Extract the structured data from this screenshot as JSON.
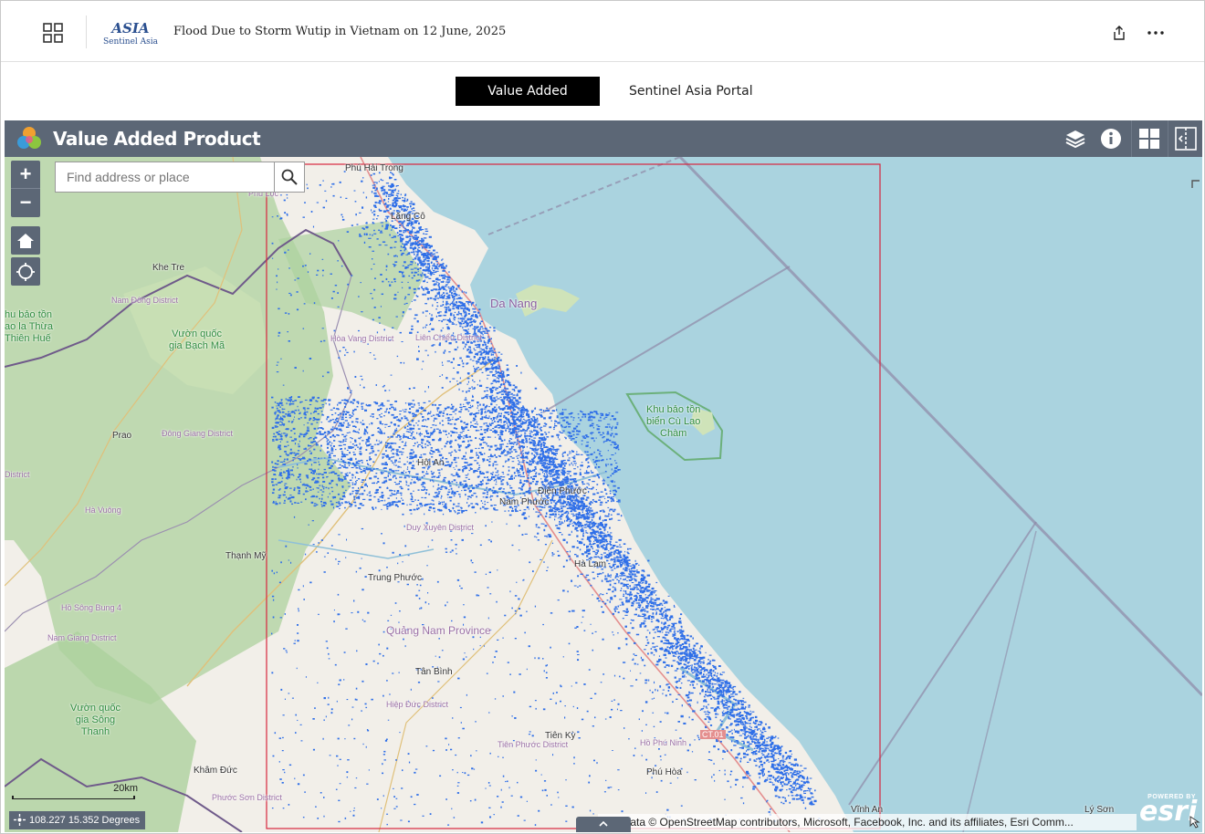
{
  "header": {
    "title": "Flood Due to Storm Wutip in Vietnam on 12 June, 2025",
    "logo_mark": "ASIA",
    "logo_text": "Sentinel Asia",
    "icons": {
      "launcher": "app-launcher-icon",
      "share": "share-icon",
      "more": "more-icon"
    }
  },
  "nav": {
    "tabs": [
      {
        "label": "Value Added Product",
        "active": true
      },
      {
        "label": "Sentinel Asia Portal",
        "active": false
      }
    ]
  },
  "widget": {
    "title": "Value Added Product",
    "tools": [
      "layers-icon",
      "info-icon",
      "grid-icon",
      "panel-toggle-icon"
    ]
  },
  "map": {
    "search": {
      "placeholder": "Find address or place",
      "value": ""
    },
    "zoom_in": "+",
    "zoom_out": "−",
    "scale": "20km",
    "coordinates": "108.227 15.352 Degrees",
    "attribution": "Map data © OpenStreetMap contributors, Microsoft, Facebook, Inc. and its affiliates, Esri Comm...",
    "powered_by": "POWERED BY",
    "esri": "esri",
    "labels": {
      "phu_hai_trong": "Phú Hải Trong",
      "phu_loc": "Phú Lộc",
      "lang_co": "Lăng Cô",
      "khe_tre": "Khe Tre",
      "nam_dong": "Nam Đông District",
      "park_thua_thien": "hu bảo tồn\nao la Thừa\nThiên Huế",
      "park_bach_ma": "Vườn quốc\ngia Bạch Mã",
      "da_nang": "Da Nang",
      "hoa_vang": "Hòa Vang District",
      "lien_chieu": "Liên Chiểu District",
      "park_cu_lao": "Khu bảo tồn\nbiển Cù Lao\nChàm",
      "prao": "Prao",
      "dong_giang": "Đông Giang District",
      "district_left": "District",
      "hoi_an": "Hội An",
      "dien_phuoc": "Điện Phước",
      "nam_phuoc": "Nam Phước",
      "ha_vuong": "Hà Vuông",
      "duy_xuyen": "Duy Xuyên District",
      "thanh_my": "Thạnh Mỹ",
      "trung_phuoc": "Trung Phước",
      "ha_lam": "Hà Lam",
      "ho_song_bung": "Hồ Sông Bung 4",
      "quang_nam": "Quảng Nam Province",
      "nam_giang": "Nam Giang District",
      "tan_binh": "Tân Bình",
      "park_song_thanh": "Vườn quốc\ngia Sông\nThanh",
      "hiep_duc": "Hiệp Đức District",
      "tien_ky": "Tiên Kỳ",
      "tien_phuoc": "Tiên Phước District",
      "ho_phu_ninh": "Hồ Phú Ninh",
      "ct01": "CT.01",
      "khan_duc": "Khâm Đức",
      "phu_hoa": "Phú Hòa",
      "phuoc_son": "Phước Sơn District",
      "vinh_an": "Vĩnh An",
      "ly_son": "Lý Sơn"
    }
  },
  "colors": {
    "header_bar": "#5c6776",
    "sea": "#aad3df",
    "land": "#f2efe9",
    "forest": "#add19e",
    "flood": "#2f6fe8",
    "aoi": "#d7263d"
  }
}
